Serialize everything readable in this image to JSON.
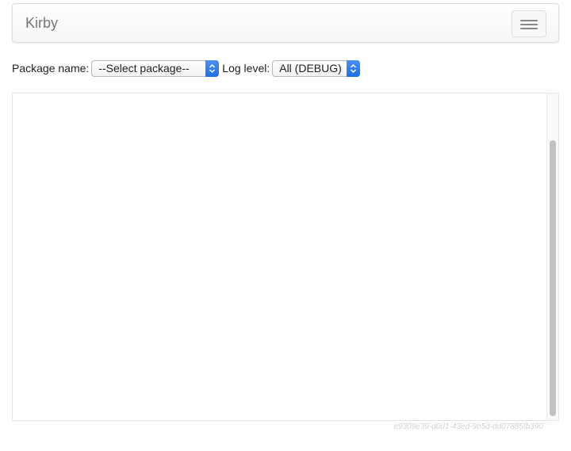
{
  "navbar": {
    "brand": "Kirby",
    "toggle_icon": "hamburger-menu-icon"
  },
  "controls": {
    "package_label": "Package name:",
    "package_select_value": "--Select package--",
    "level_label": "Log level:",
    "level_select_value": "All (DEBUG)",
    "select_accent_color": "#2a7bee"
  },
  "log_panel": {
    "content": ""
  },
  "footer": {
    "id_text": "e9309e39-d0d1-43ed-9b5d-dd07885fb390"
  }
}
